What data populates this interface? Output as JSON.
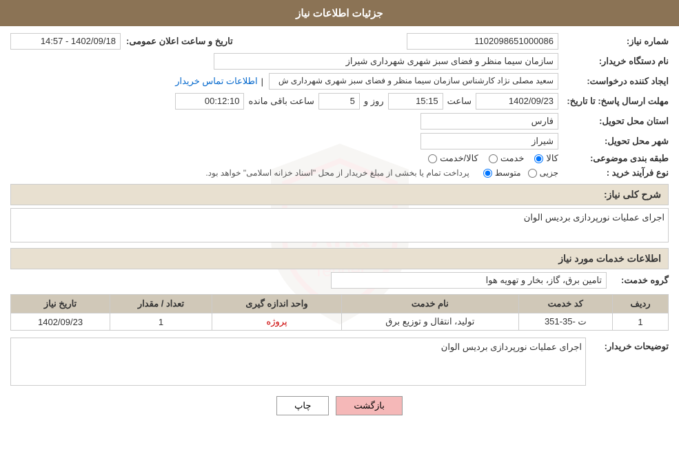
{
  "header": {
    "title": "جزئیات اطلاعات نیاز"
  },
  "fields": {
    "need_number_label": "شماره نیاز:",
    "need_number_value": "1102098651000086",
    "announce_datetime_label": "تاریخ و ساعت اعلان عمومی:",
    "announce_datetime_value": "1402/09/18 - 14:57",
    "buyer_org_label": "نام دستگاه خریدار:",
    "buyer_org_value": "سازمان سیما منظر و فضای سبز شهری شهرداری شیراز",
    "creator_label": "ایجاد کننده درخواست:",
    "creator_value": "سعید مصلی نژاد کارشناس سازمان سیما منظر و فضای سبز شهری شهرداری ش",
    "creator_link": "اطلاعات تماس خریدار",
    "response_deadline_label": "مهلت ارسال پاسخ: تا تاریخ:",
    "response_date": "1402/09/23",
    "response_time_label": "ساعت",
    "response_time": "15:15",
    "response_days_label": "روز و",
    "response_days": "5",
    "response_remain_label": "ساعت باقی مانده",
    "response_remain": "00:12:10",
    "province_label": "استان محل تحویل:",
    "province_value": "فارس",
    "city_label": "شهر محل تحویل:",
    "city_value": "شیراز",
    "category_label": "طبقه بندی موضوعی:",
    "category_options": [
      "کالا",
      "خدمت",
      "کالا/خدمت"
    ],
    "category_selected": "کالا",
    "process_label": "نوع فرآیند خرید :",
    "process_options": [
      "جزیی",
      "متوسط"
    ],
    "process_text": "پرداخت تمام یا بخشی از مبلغ خریدار از محل \"اسناد خزانه اسلامی\" خواهد بود.",
    "need_desc_label": "شرح کلی نیاز:",
    "need_desc_value": "اجرای عملیات نورپردازی بردیس الوان",
    "services_section_label": "اطلاعات خدمات مورد نیاز",
    "service_group_label": "گروه خدمت:",
    "service_group_value": "تامین برق، گاز، بخار و تهویه هوا",
    "table": {
      "columns": [
        "ردیف",
        "کد خدمت",
        "نام خدمت",
        "واحد اندازه گیری",
        "تعداد / مقدار",
        "تاریخ نیاز"
      ],
      "rows": [
        {
          "row_num": "1",
          "service_code": "ت -35-351",
          "service_name": "تولید، انتقال و توزیع برق",
          "unit": "پروژه",
          "quantity": "1",
          "date": "1402/09/23"
        }
      ]
    },
    "buyer_notes_label": "توضیحات خریدار:",
    "buyer_notes_value": "اجرای عملیات نورپردازی بردیس الوان"
  },
  "buttons": {
    "print_label": "چاپ",
    "back_label": "بازگشت"
  }
}
